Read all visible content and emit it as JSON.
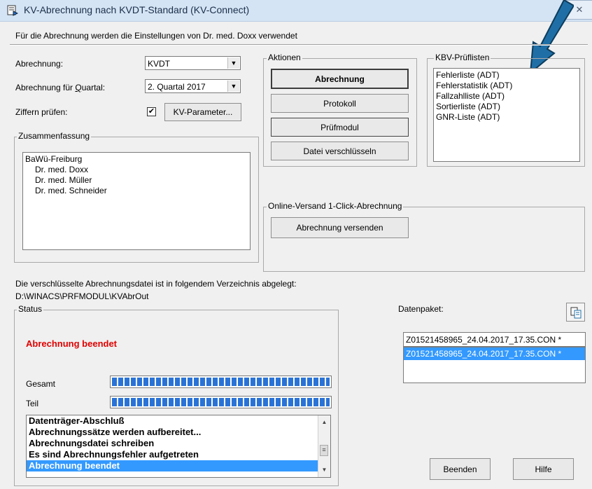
{
  "window": {
    "title": "KV-Abrechnung nach KVDT-Standard (KV-Connect)",
    "subtitle": "Für die Abrechnung werden die Einstellungen von Dr. med. Doxx verwendet",
    "close_glyph": "✕"
  },
  "settings": {
    "abrechnung_label": "Abrechnung:",
    "abrechnung_value": "KVDT",
    "quartal_label_prefix": "Abrechnung für ",
    "quartal_label_underlined": "Q",
    "quartal_label_suffix": "uartal:",
    "quartal_value": "2. Quartal 2017",
    "ziffern_label": "Ziffern prüfen:",
    "ziffern_checked": "✔",
    "kv_parameter_button": "KV-Parameter..."
  },
  "zusammenfassung": {
    "title": "Zusammenfassung",
    "items": [
      "BaWü-Freiburg",
      "Dr. med. Doxx",
      "Dr. med. Müller",
      "Dr. med. Schneider"
    ]
  },
  "aktionen": {
    "title": "Aktionen",
    "abrechnung_button": "Abrechnung",
    "protokoll_button": "Protokoll",
    "pruefmodul_button": "Prüfmodul",
    "verschluesseln_button": "Datei verschlüsseln"
  },
  "kbv": {
    "title": "KBV-Prüflisten",
    "items": [
      "Fehlerliste (ADT)",
      "Fehlerstatistik (ADT)",
      "Fallzahlliste (ADT)",
      "Sortierliste (ADT)",
      "GNR-Liste (ADT)"
    ]
  },
  "online": {
    "title": "Online-Versand 1-Click-Abrechnung",
    "send_button": "Abrechnung versenden"
  },
  "path": {
    "info": "Die verschlüsselte Abrechnungsdatei ist in folgendem Verzeichnis abgelegt:",
    "value": "D:\\WINACS\\PRFMODUL\\KVAbrOut"
  },
  "status": {
    "title": "Status",
    "message": "Abrechnung beendet",
    "gesamt_label": "Gesamt",
    "teil_label": "Teil",
    "gesamt_progress": 1.0,
    "teil_progress": 1.0,
    "log": [
      "Datenträger-Abschluß",
      "Abrechnungssätze werden aufbereitet...",
      "Abrechnungsdatei schreiben",
      "Es sind Abrechnungsfehler aufgetreten",
      "Abrechnung beendet"
    ],
    "log_selected_index": 4
  },
  "datenpaket": {
    "label": "Datenpaket:",
    "input_value": "Z01521458965_24.04.2017_17.35.CON *",
    "list_items": [
      "Z01521458965_24.04.2017_17.35.CON *"
    ]
  },
  "footer": {
    "beenden_button": "Beenden",
    "hilfe_button": "Hilfe"
  },
  "colors": {
    "status_message": "#e00000",
    "selection": "#3399ff",
    "progress": "#2a73d6",
    "arrow": "#1f6fa6"
  }
}
